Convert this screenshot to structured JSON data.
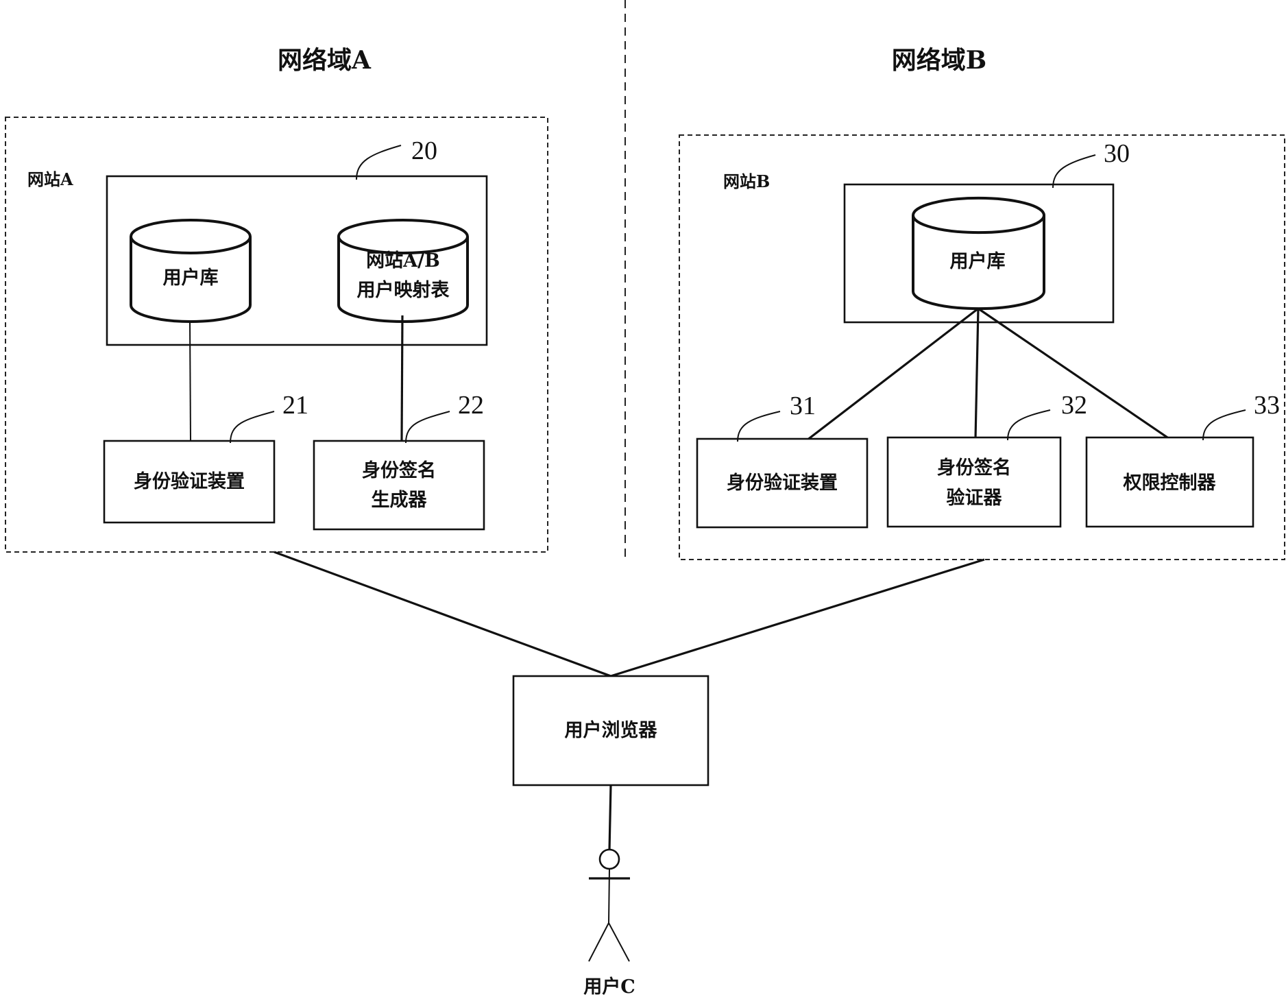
{
  "domains": {
    "a": {
      "title": "网络域A"
    },
    "b": {
      "title": "网络域B"
    }
  },
  "site_a": {
    "label": "网站A",
    "storage_ref": "20",
    "user_db": "用户库",
    "mapping_table": {
      "line1": "网站A/B",
      "line2": "用户映射表"
    },
    "auth_device": {
      "ref": "21",
      "label": "身份验证装置"
    },
    "signature_generator": {
      "ref": "22",
      "line1": "身份签名",
      "line2": "生成器"
    }
  },
  "site_b": {
    "label": "网站B",
    "storage_ref": "30",
    "user_db": "用户库",
    "auth_device": {
      "ref": "31",
      "label": "身份验证装置"
    },
    "signature_verifier": {
      "ref": "32",
      "line1": "身份签名",
      "line2": "验证器"
    },
    "access_controller": {
      "ref": "33",
      "label": "权限控制器"
    }
  },
  "client": {
    "browser": "用户浏览器",
    "user": "用户C"
  }
}
